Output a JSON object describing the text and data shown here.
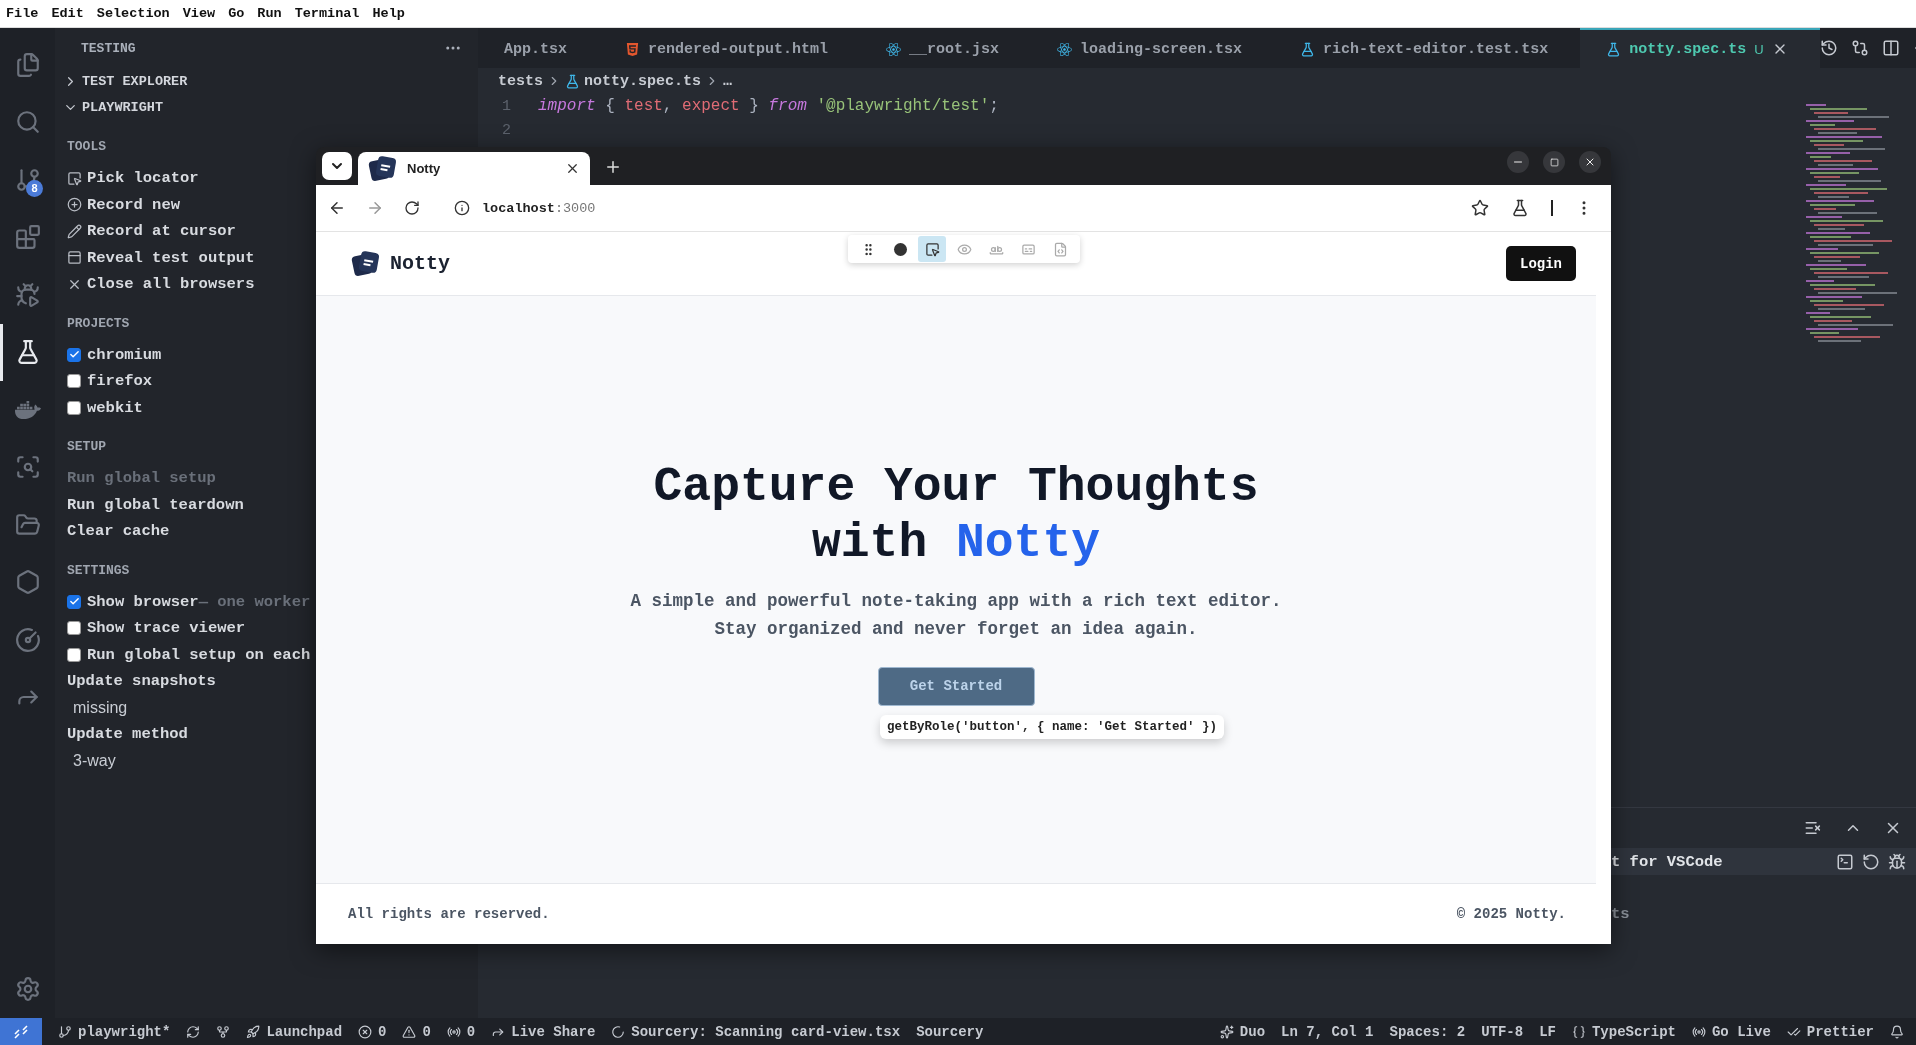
{
  "menu_bar": [
    "File",
    "Edit",
    "Selection",
    "View",
    "Go",
    "Run",
    "Terminal",
    "Help"
  ],
  "activity_bar": [
    {
      "kind": "files",
      "selected": false
    },
    {
      "kind": "search",
      "selected": false
    },
    {
      "kind": "scm",
      "selected": false,
      "badge": "8"
    },
    {
      "kind": "extensions",
      "selected": false
    },
    {
      "kind": "debug",
      "selected": false
    },
    {
      "kind": "testing",
      "selected": true
    },
    {
      "kind": "docker",
      "selected": false
    },
    {
      "kind": "remote",
      "selected": false
    },
    {
      "kind": "folders",
      "selected": false
    },
    {
      "kind": "hexagon",
      "selected": false
    },
    {
      "kind": "gauge",
      "selected": false
    },
    {
      "kind": "share",
      "selected": false
    }
  ],
  "sidebar": {
    "title": "TESTING",
    "views": [
      {
        "label": "TEST EXPLORER",
        "expanded": false
      },
      {
        "label": "PLAYWRIGHT",
        "expanded": true
      }
    ],
    "groups": [
      {
        "heading": "TOOLS",
        "items": [
          {
            "kind": "pick",
            "label": "Pick locator"
          },
          {
            "kind": "record",
            "label": "Record new"
          },
          {
            "kind": "edit",
            "label": "Record at cursor"
          },
          {
            "kind": "reveal",
            "label": "Reveal test output"
          },
          {
            "kind": "close",
            "label": "Close all browsers"
          }
        ]
      },
      {
        "heading": "PROJECTS",
        "items": [
          {
            "kind": "checkbox",
            "label": "chromium",
            "checked": true
          },
          {
            "kind": "checkbox",
            "label": "firefox",
            "checked": false
          },
          {
            "kind": "checkbox",
            "label": "webkit",
            "checked": false
          }
        ]
      },
      {
        "heading": "SETUP",
        "items": [
          {
            "kind": "link",
            "label": "Run global setup",
            "disabled": true
          },
          {
            "kind": "link",
            "label": "Run global teardown",
            "disabled": false
          },
          {
            "kind": "link",
            "label": "Clear cache",
            "disabled": false
          }
        ]
      },
      {
        "heading": "SETTINGS",
        "items": [
          {
            "kind": "checkbox",
            "label": "Show browser",
            "hint": "— one worker",
            "checked": true
          },
          {
            "kind": "checkbox",
            "label": "Show trace viewer",
            "checked": false
          },
          {
            "kind": "checkbox",
            "label": "Run global setup on each",
            "checked": false
          },
          {
            "kind": "option",
            "label": "Update snapshots",
            "value": "missing"
          },
          {
            "kind": "option",
            "label": "Update method",
            "value": "3-way"
          }
        ]
      }
    ]
  },
  "editor": {
    "tabs": [
      {
        "label": "App.tsx",
        "kind": "plain",
        "selected": false
      },
      {
        "label": "rendered-output.html",
        "kind": "html",
        "selected": false
      },
      {
        "label": "__root.jsx",
        "kind": "react",
        "selected": false
      },
      {
        "label": "loading-screen.tsx",
        "kind": "react",
        "selected": false
      },
      {
        "label": "rich-text-editor.test.tsx",
        "kind": "test",
        "selected": false
      },
      {
        "label": "notty.spec.ts",
        "kind": "test",
        "selected": true,
        "badge": "U"
      }
    ],
    "breadcrumbs": [
      {
        "label": "tests",
        "kind": "folder"
      },
      {
        "label": "notty.spec.ts",
        "kind": "test"
      },
      {
        "label": "…",
        "kind": "folder"
      }
    ],
    "lines": [
      {
        "number": "1",
        "tokens": [
          {
            "text": "import",
            "kind": "keyword"
          },
          {
            "text": " { ",
            "kind": "punct"
          },
          {
            "text": "test",
            "kind": "var"
          },
          {
            "text": ", ",
            "kind": "punct"
          },
          {
            "text": "expect",
            "kind": "var"
          },
          {
            "text": " } ",
            "kind": "punct"
          },
          {
            "text": "from",
            "kind": "keyword"
          },
          {
            "text": " '@playwright/test'",
            "kind": "string"
          },
          {
            "text": ";",
            "kind": "punct"
          }
        ]
      },
      {
        "number": "2"
      }
    ]
  },
  "panel": {
    "selected_row": "t for VSCode",
    "row": "ts"
  },
  "browser": {
    "tab_title": "Notty",
    "url_host": "localhost",
    "url_port": ":3000",
    "recorder_tools": [
      {
        "kind": "grip",
        "selected": false
      },
      {
        "kind": "record",
        "selected": false
      },
      {
        "kind": "pick",
        "selected": true
      },
      {
        "kind": "eye",
        "selected": false
      },
      {
        "kind": "text",
        "selected": false
      },
      {
        "kind": "value",
        "selected": false
      },
      {
        "kind": "snapshot",
        "selected": false
      }
    ],
    "page": {
      "brand": "Notty",
      "login": "Login",
      "headline": "Capture Your Thoughts",
      "headline_lead": "with",
      "headline_accent": "Notty",
      "subtitle": "A simple and powerful note-taking app with a rich text editor. Stay organized and never forget an idea again.",
      "cta": "Get Started",
      "locator": "getByRole('button', { name: 'Get Started' })",
      "footer_left": "All rights are reserved.",
      "footer_right": "© 2025 Notty."
    }
  },
  "status_bar": {
    "left": [
      {
        "kind": "remote"
      },
      {
        "kind": "branch",
        "text": "playwright*"
      },
      {
        "kind": "sync"
      },
      {
        "kind": "graph"
      },
      {
        "kind": "launchpad",
        "text": "Launchpad"
      },
      {
        "kind": "errors",
        "text": "0"
      },
      {
        "kind": "warnings",
        "text": "0"
      },
      {
        "kind": "ports",
        "text": "0"
      },
      {
        "kind": "share",
        "text": "Live Share"
      },
      {
        "kind": "spinner",
        "text": "Sourcery: Scanning card-view.tsx"
      },
      {
        "kind": "plain",
        "text": "Sourcery"
      }
    ],
    "right": [
      {
        "kind": "duo",
        "text": "Duo"
      },
      {
        "kind": "plain",
        "text": "Ln 7, Col 1"
      },
      {
        "kind": "plain",
        "text": "Spaces: 2"
      },
      {
        "kind": "plain",
        "text": "UTF-8"
      },
      {
        "kind": "plain",
        "text": "LF"
      },
      {
        "kind": "braces",
        "text": "TypeScript"
      },
      {
        "kind": "live",
        "text": "Go Live"
      },
      {
        "kind": "check",
        "text": "Prettier"
      },
      {
        "kind": "bell"
      }
    ]
  }
}
